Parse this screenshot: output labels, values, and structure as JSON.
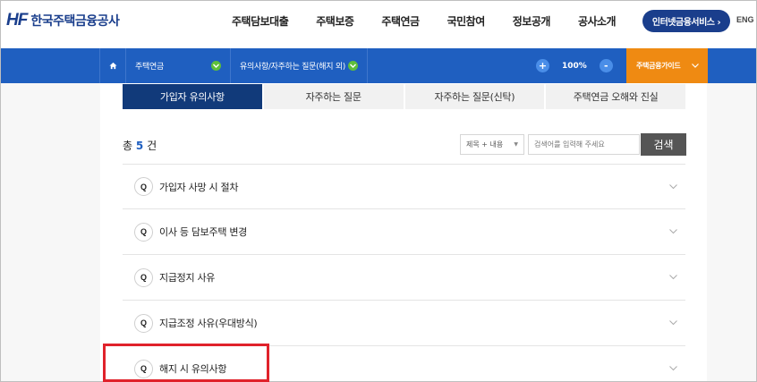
{
  "header": {
    "logo_mark": "HF",
    "logo_name": "한국주택금융공사",
    "nav": [
      "주택담보대출",
      "주택보증",
      "주택연금",
      "국민참여",
      "정보공개",
      "공사소개"
    ],
    "internet_service": "인터넷금융서비스 ›",
    "lang": "ENG"
  },
  "locbar": {
    "crumb1": "주택연금",
    "crumb2": "유의사항/자주하는 질문(해지 외)",
    "zoom_in": "+",
    "zoom_value": "100%",
    "zoom_out": "-",
    "guide": "주택금융가이드"
  },
  "tabs": [
    "가입자 유의사항",
    "자주하는 질문",
    "자주하는 질문(신탁)",
    "주택연금 오해와 진실"
  ],
  "active_tab": 0,
  "list_header": {
    "prefix": "총",
    "count": "5",
    "suffix": "건"
  },
  "search": {
    "scope": "제목 + 내용",
    "placeholder": "검색어를 입력해 주세요",
    "button": "검색"
  },
  "faq": {
    "badge": "Q",
    "items": [
      "가입자 사망 시 절차",
      "이사 등 담보주택 변경",
      "지급정지 사유",
      "지급조정 사유(우대방식)",
      "해지 시 유의사항"
    ]
  },
  "colors": {
    "primary": "#1f5fc0",
    "navy": "#113a7a",
    "orange": "#ef8a12",
    "highlight": "#e0222b"
  }
}
